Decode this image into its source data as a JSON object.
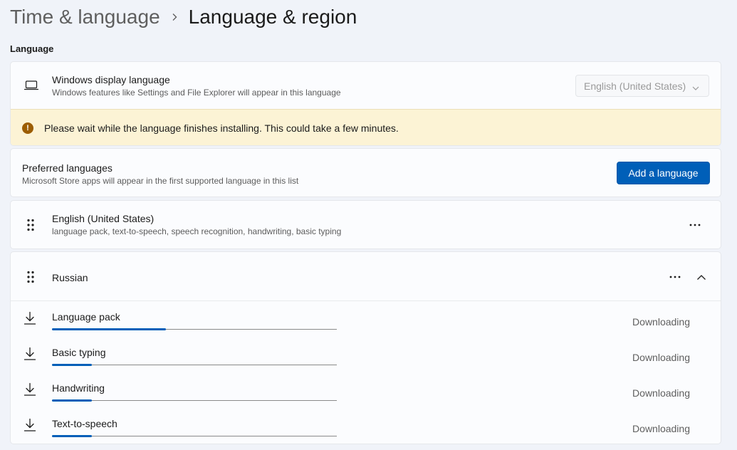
{
  "breadcrumb": {
    "parent": "Time & language",
    "current": "Language & region"
  },
  "section_label": "Language",
  "display_language": {
    "title": "Windows display language",
    "description": "Windows features like Settings and File Explorer will appear in this language",
    "selected": "English (United States)",
    "icon": "laptop-icon"
  },
  "warning": {
    "text": "Please wait while the language finishes installing. This could take a few minutes.",
    "icon": "warning-icon"
  },
  "preferred": {
    "title": "Preferred languages",
    "description": "Microsoft Store apps will appear in the first supported language in this list",
    "add_button": "Add a language"
  },
  "languages": [
    {
      "name": "English (United States)",
      "features": "language pack, text-to-speech, speech recognition, handwriting, basic typing"
    },
    {
      "name": "Russian",
      "downloads": [
        {
          "name": "Language pack",
          "status": "Downloading",
          "progress": 0.4
        },
        {
          "name": "Basic typing",
          "status": "Downloading",
          "progress": 0.14
        },
        {
          "name": "Handwriting",
          "status": "Downloading",
          "progress": 0.14
        },
        {
          "name": "Text-to-speech",
          "status": "Downloading",
          "progress": 0.14
        }
      ]
    }
  ],
  "colors": {
    "accent": "#005fb8",
    "warning_bg": "#fcf3d5",
    "warning_icon": "#9c5d00"
  }
}
